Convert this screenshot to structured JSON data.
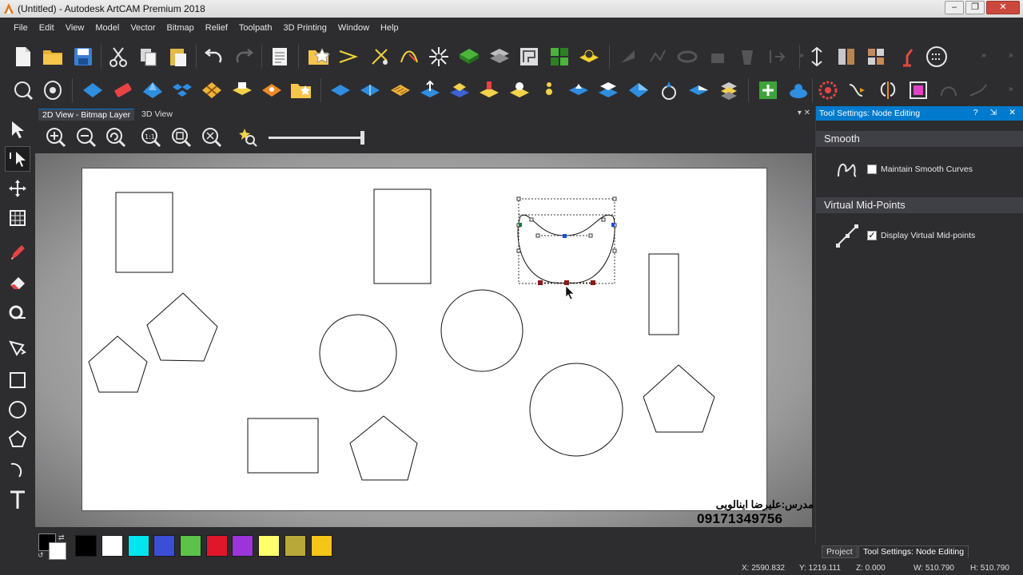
{
  "window": {
    "title": "(Untitled) - Autodesk ArtCAM Premium 2018",
    "minimize": "–",
    "maximize": "❐",
    "close": "✕"
  },
  "menu": [
    "File",
    "Edit",
    "View",
    "Model",
    "Vector",
    "Bitmap",
    "Relief",
    "Toolpath",
    "3D Printing",
    "Window",
    "Help"
  ],
  "view_tabs": {
    "active": "2D View - Bitmap Layer",
    "other": "3D View",
    "controls": "▾ ✕"
  },
  "view_toolbar": {
    "zoom_level": 1.0
  },
  "panel": {
    "title": "Tool Settings: Node Editing",
    "controls": "? ⇲ ✕",
    "sections": [
      {
        "title": "Smooth",
        "option": {
          "label": "Maintain Smooth Curves",
          "checked": false,
          "check_glyph": ""
        }
      },
      {
        "title": "Virtual Mid-Points",
        "option": {
          "label": "Display Virtual Mid-points",
          "checked": true,
          "check_glyph": "✓"
        }
      }
    ]
  },
  "bottom_tabs": [
    "Project",
    "Tool Settings: Node Editing"
  ],
  "palette": {
    "colors": [
      "#000000",
      "#ffffff",
      "#00e5ee",
      "#3a4fd6",
      "#5cc24a",
      "#e0162b",
      "#9b35d9",
      "#ffff6b",
      "#b8a83a",
      "#f5c518"
    ]
  },
  "watermark": {
    "teacher": "مدرس:علیرضا اینالویی",
    "phone": "09171349756"
  },
  "status": {
    "x": "X: 2590.832",
    "y": "Y: 1219.111",
    "z": "Z: 0.000",
    "w": "W: 510.790",
    "h": "H: 510.790"
  }
}
